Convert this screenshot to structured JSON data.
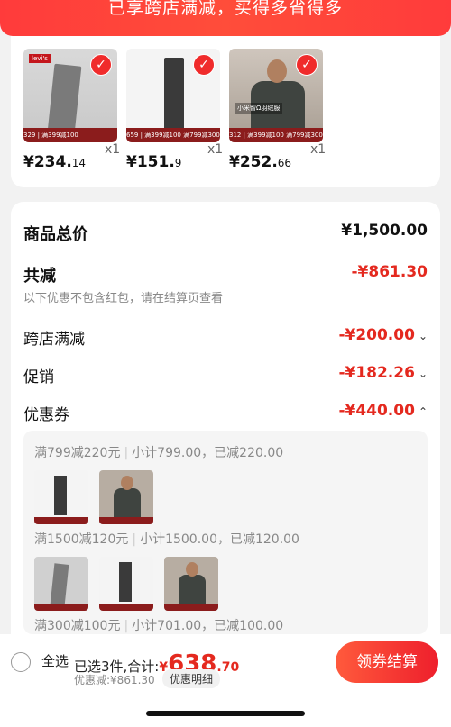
{
  "banner": {
    "text": "已享跨店满减，买得多省得多"
  },
  "products": [
    {
      "name": "grey-jeans",
      "brand": "Levi's",
      "price_main": "¥234.",
      "price_dec": "14",
      "qty": "x1",
      "bar": "329 | 满399减100"
    },
    {
      "name": "dark-jeans",
      "price_main": "¥151.",
      "price_dec": "9",
      "qty": "x1",
      "bar": "659 | 满399减100 满799减300"
    },
    {
      "name": "jacket",
      "badge": "小米智Ω羽绒服",
      "price_main": "¥252.",
      "price_dec": "66",
      "qty": "x1",
      "bar": "312 | 满399减100 满799减300"
    }
  ],
  "summary": {
    "total_label": "商品总价",
    "total_value": "¥1,500.00",
    "reduce_label": "共减",
    "reduce_value": "-¥861.30",
    "note": "以下优惠不包含红包，请在结算页查看",
    "cross_label": "跨店满减",
    "cross_value": "-¥200.00",
    "promo_label": "促销",
    "promo_value": "-¥182.26",
    "coupon_label": "优惠券",
    "coupon_value": "-¥440.00"
  },
  "coupons": [
    {
      "rule": "满799减220元",
      "detail": "小计799.00，已减220.00"
    },
    {
      "rule": "满1500减120元",
      "detail": "小计1500.00，已减120.00"
    },
    {
      "rule": "满300减100元",
      "detail": "小计701.00，已减100.00"
    }
  ],
  "footer": {
    "select_all": "全选",
    "selected": "已选3件,合计:",
    "currency": "¥",
    "total_int": "638",
    "total_dec": ".70",
    "discount": "优惠减:¥861.30",
    "detail_btn": "优惠明细",
    "pay_btn": "领券结算"
  },
  "colors": {
    "accent": "#e4291f",
    "banner": "#ff3b3b"
  }
}
